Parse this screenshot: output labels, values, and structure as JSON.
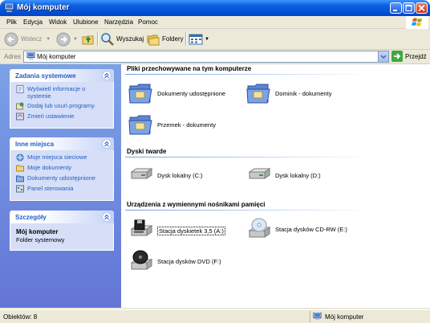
{
  "window": {
    "title": "Mój komputer"
  },
  "menu": [
    "Plik",
    "Edycja",
    "Widok",
    "Ulubione",
    "Narzędzia",
    "Pomoc"
  ],
  "toolbar": {
    "back": "Wstecz",
    "search": "Wyszukaj",
    "folders": "Foldery"
  },
  "address": {
    "label": "Adres",
    "value": "Mój komputer",
    "go": "Przejdź"
  },
  "left": {
    "tasks": {
      "title": "Zadania systemowe",
      "items": [
        "Wyświetl informacje o systemie",
        "Dodaj lub usuń programy",
        "Zmień ustawienie"
      ]
    },
    "places": {
      "title": "Inne miejsca",
      "items": [
        "Moje miejsca sieciowe",
        "Moje dokumenty",
        "Dokumenty udostępnione",
        "Panel sterowania"
      ]
    },
    "details": {
      "title": "Szczegóły",
      "name": "Mój komputer",
      "type": "Folder systemowy"
    }
  },
  "sections": {
    "files": {
      "title": "Pliki przechowywane na tym komputerze",
      "items": [
        "Dokumenty udostępnione",
        "Dominik - dokumenty",
        "Przemek - dokumenty"
      ]
    },
    "drives": {
      "title": "Dyski twarde",
      "items": [
        "Dysk lokalny (C:)",
        "Dysk lokalny (D:)"
      ]
    },
    "removable": {
      "title": "Urządzenia z wymiennymi nośnikami pamięci",
      "items": [
        "Stacja dyskietek 3,5 (A:)",
        "Stacja dysków CD-RW (E:)",
        "Stacja dysków DVD (F:)"
      ]
    }
  },
  "status": {
    "count": "Obiektów: 8",
    "location": "Mój komputer"
  }
}
